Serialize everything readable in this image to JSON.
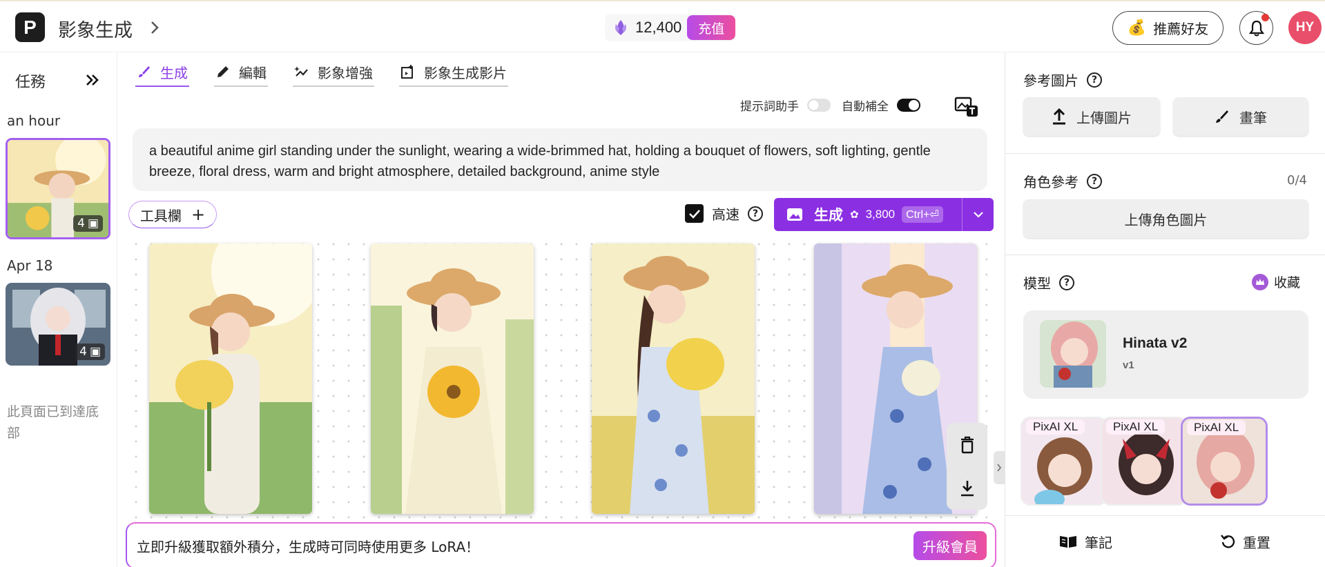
{
  "header": {
    "logo_letter": "P",
    "app_title": "影象生成",
    "credits": "12,400",
    "recharge_label": "充值",
    "refer_label": "推薦好友",
    "avatar_initials": "HY"
  },
  "left_sidebar": {
    "tasks_label": "任務",
    "groups": [
      {
        "label": "an hour",
        "count": "4"
      },
      {
        "label": "Apr 18",
        "count": "4"
      }
    ],
    "end_text": "此頁面已到達底部"
  },
  "tabs": [
    {
      "label": "生成",
      "icon": "brush-icon",
      "active": true
    },
    {
      "label": "編輯",
      "icon": "pencil-icon",
      "active": false
    },
    {
      "label": "影象增強",
      "icon": "enhance-icon",
      "active": false
    },
    {
      "label": "影象生成影片",
      "icon": "video-add-icon",
      "active": false
    }
  ],
  "toggles": {
    "prompt_helper_label": "提示詞助手",
    "prompt_helper_on": false,
    "autocomplete_label": "自動補全",
    "autocomplete_on": true
  },
  "prompt": {
    "text": "a beautiful anime girl standing under the sunlight, wearing a wide-brimmed hat, holding a bouquet of flowers, soft lighting, gentle breeze, floral dress, warm and bright atmosphere, detailed background, anime style"
  },
  "toolbar": {
    "tools_label": "工具欄",
    "fast_label": "高速",
    "fast_checked": true,
    "generate_label": "生成",
    "generate_cost": "3,800",
    "shortcut": "Ctrl+⏎"
  },
  "gallery": {
    "images": [
      {
        "name": "generated-image-1"
      },
      {
        "name": "generated-image-2"
      },
      {
        "name": "generated-image-3"
      },
      {
        "name": "generated-image-4"
      }
    ]
  },
  "upgrade_banner": {
    "message": "立即升級獲取額外積分，生成時可同時使用更多 LoRA！",
    "button_label": "升級會員"
  },
  "right_panel": {
    "reference_title": "參考圖片",
    "upload_image_label": "上傳圖片",
    "brush_label": "畫筆",
    "character_title": "角色參考",
    "character_count": "0/4",
    "upload_character_label": "上傳角色圖片",
    "model_title": "模型",
    "favorites_label": "收藏",
    "model_name": "Hinata v2",
    "model_version": "v1",
    "base_models": [
      {
        "tag": "PixAI XL",
        "selected": false
      },
      {
        "tag": "PixAI XL",
        "selected": false
      },
      {
        "tag": "PixAI XL",
        "selected": true
      }
    ],
    "notes_label": "筆記",
    "reset_label": "重置"
  },
  "colors": {
    "accent_purple": "#8b2fe3",
    "pink_gradient_end": "#ec4f9e",
    "avatar_bg": "#e94f6a"
  }
}
